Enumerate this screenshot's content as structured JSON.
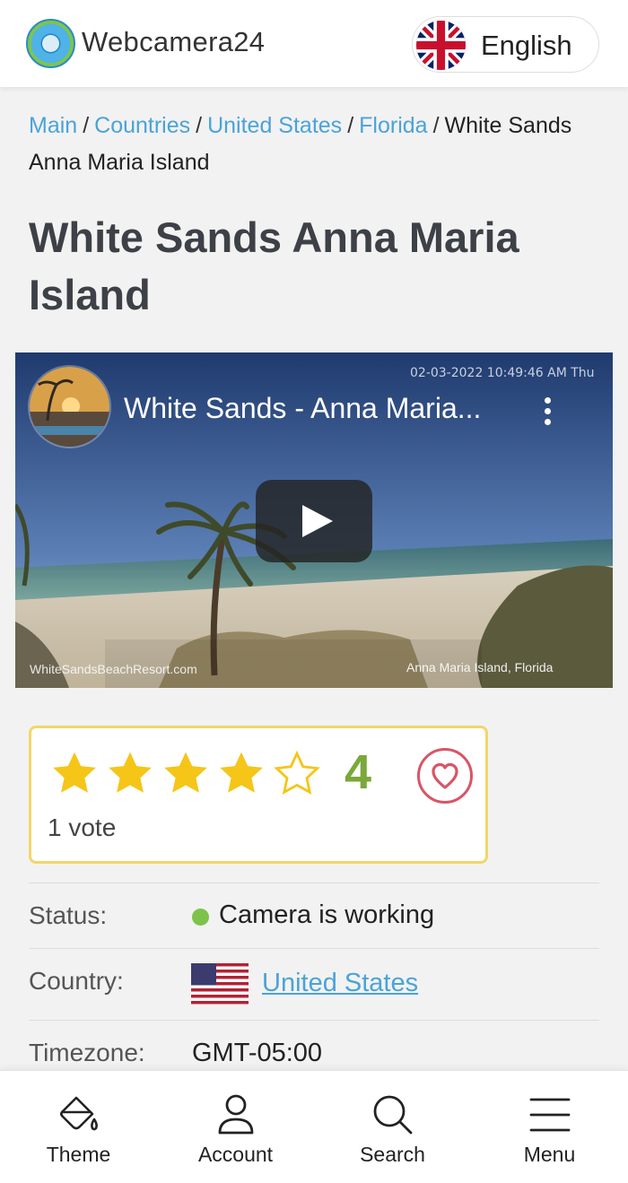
{
  "header": {
    "brand": "Webcamera24",
    "language": "English",
    "logo_icon": "camera-aperture-logo",
    "flag_icon": "uk-flag-icon"
  },
  "breadcrumb": {
    "items": [
      "Main",
      "Countries",
      "United States",
      "Florida"
    ],
    "current": "White Sands Anna Maria Island",
    "separator": "/"
  },
  "page": {
    "title": "White Sands Anna Maria Island"
  },
  "video": {
    "title": "White Sands - Anna Maria...",
    "timestamp": "02-03-2022 10:49:46 AM Thu",
    "watermark_left": "WhiteSandsBeachResort.com",
    "watermark_right": "Anna Maria Island, Florida"
  },
  "rating": {
    "value": "4",
    "stars_filled": 4,
    "stars_total": 5,
    "votes": "1 vote",
    "star_color": "#f5c518",
    "value_color": "#7aa83a"
  },
  "info": {
    "status_label": "Status:",
    "status_value": "Camera is working",
    "status_color": "#7dc34a",
    "country_label": "Country:",
    "country_value": "United States",
    "timezone_label": "Timezone:",
    "timezone_value": "GMT-05:00"
  },
  "bottom_nav": {
    "theme": "Theme",
    "account": "Account",
    "search": "Search",
    "menu": "Menu"
  },
  "colors": {
    "link": "#4aa3d8",
    "title": "#3d4147",
    "rating_border": "#f2d66b",
    "heart": "#d95566"
  }
}
